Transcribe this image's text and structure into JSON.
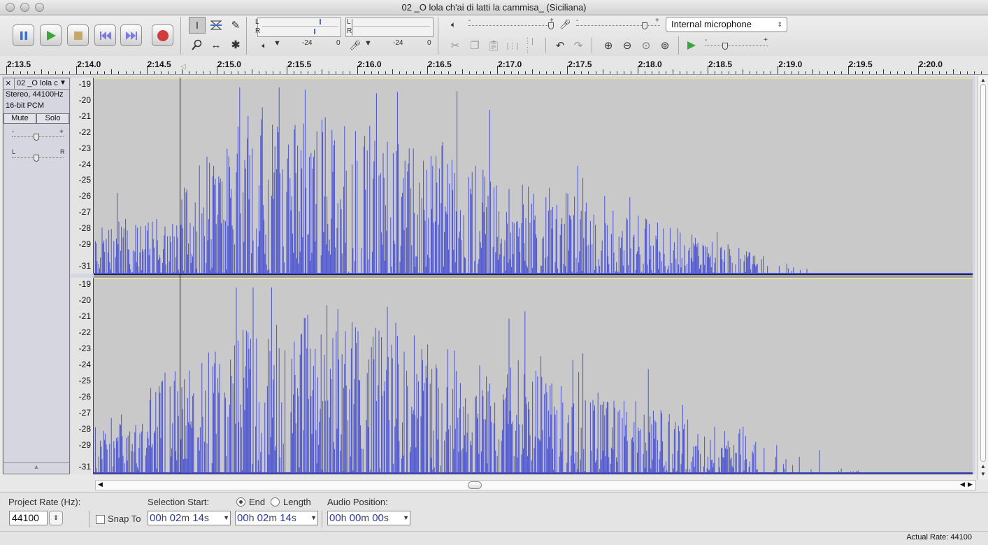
{
  "window": {
    "title": "02 _O lola ch'ai di latti la cammisa_ (Siciliana)"
  },
  "meters": {
    "play_left": "L",
    "play_right": "R",
    "rec_left": "L",
    "rec_right": "R",
    "play_db_mid": "-24",
    "play_db_end": "0",
    "rec_db_mid": "-24",
    "rec_db_end": "0"
  },
  "mixer": {
    "input_device": "Internal microphone"
  },
  "slider_signs": {
    "minus": "-",
    "plus": "+"
  },
  "timeline": {
    "labels": [
      "2:13.5",
      "2:14.0",
      "2:14.5",
      "2:15.0",
      "2:15.5",
      "2:16.0",
      "2:16.5",
      "2:17.0",
      "2:17.5",
      "2:18.0",
      "2:18.5",
      "2:19.0",
      "2:19.5",
      "2:20.0"
    ]
  },
  "track": {
    "name": "02 _O lola c",
    "info_line1": "Stereo, 44100Hz",
    "info_line2": "16-bit PCM",
    "mute_label": "Mute",
    "solo_label": "Solo",
    "pan_left": "L",
    "pan_right": "R",
    "db_labels": [
      "-19",
      "-20",
      "-21",
      "-22",
      "-23",
      "-24",
      "-25",
      "-26",
      "-27",
      "-28",
      "-29",
      "-31"
    ]
  },
  "colors": {
    "waveform": "#4a52d2",
    "wave_bg": "#c9c9c9",
    "selection_line": "#222222"
  },
  "statusbar": {
    "project_rate_label": "Project Rate (Hz):",
    "project_rate_value": "44100",
    "snap_to_label": "Snap To",
    "selection_start_label": "Selection Start:",
    "end_label": "End",
    "length_label": "Length",
    "audio_position_label": "Audio Position:",
    "actual_rate": "Actual Rate: 44100",
    "unit_h": "h",
    "unit_m": "m",
    "unit_s": "s",
    "selection_start": {
      "h": "00",
      "m": "02",
      "s": "14"
    },
    "selection_end": {
      "h": "00",
      "m": "02",
      "s": "14"
    },
    "audio_position": {
      "h": "00",
      "m": "00",
      "s": "00"
    }
  }
}
